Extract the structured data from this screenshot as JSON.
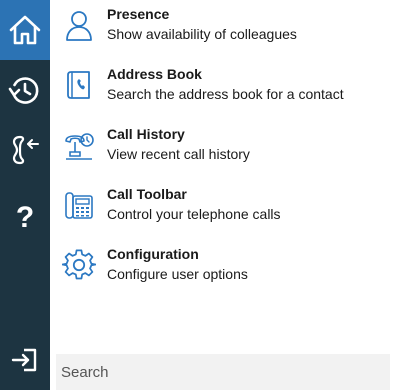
{
  "sidebar": {
    "items": [
      {
        "icon": "home-icon",
        "active": true
      },
      {
        "icon": "history-clock-icon",
        "active": false
      },
      {
        "icon": "transfer-handset-icon",
        "active": false
      },
      {
        "icon": "help-question-icon",
        "active": false
      },
      {
        "icon": "sign-out-icon",
        "active": false
      }
    ],
    "help_glyph": "?"
  },
  "menu": {
    "items": [
      {
        "title": "Presence",
        "description": "Show availability of colleagues",
        "icon": "person-icon"
      },
      {
        "title": "Address Book",
        "description": "Search the address book for a contact",
        "icon": "address-book-icon"
      },
      {
        "title": "Call History",
        "description": "View recent call history",
        "icon": "phone-history-icon"
      },
      {
        "title": "Call Toolbar",
        "description": "Control your telephone calls",
        "icon": "desk-phone-icon"
      },
      {
        "title": "Configuration",
        "description": "Configure user options",
        "icon": "gear-icon"
      }
    ]
  },
  "search": {
    "placeholder": "Search",
    "value": ""
  },
  "colors": {
    "sidebar_bg": "#1d3441",
    "active_bg": "#2c73b4",
    "icon_blue": "#2b78c2",
    "search_bg": "#f2f2f2"
  }
}
